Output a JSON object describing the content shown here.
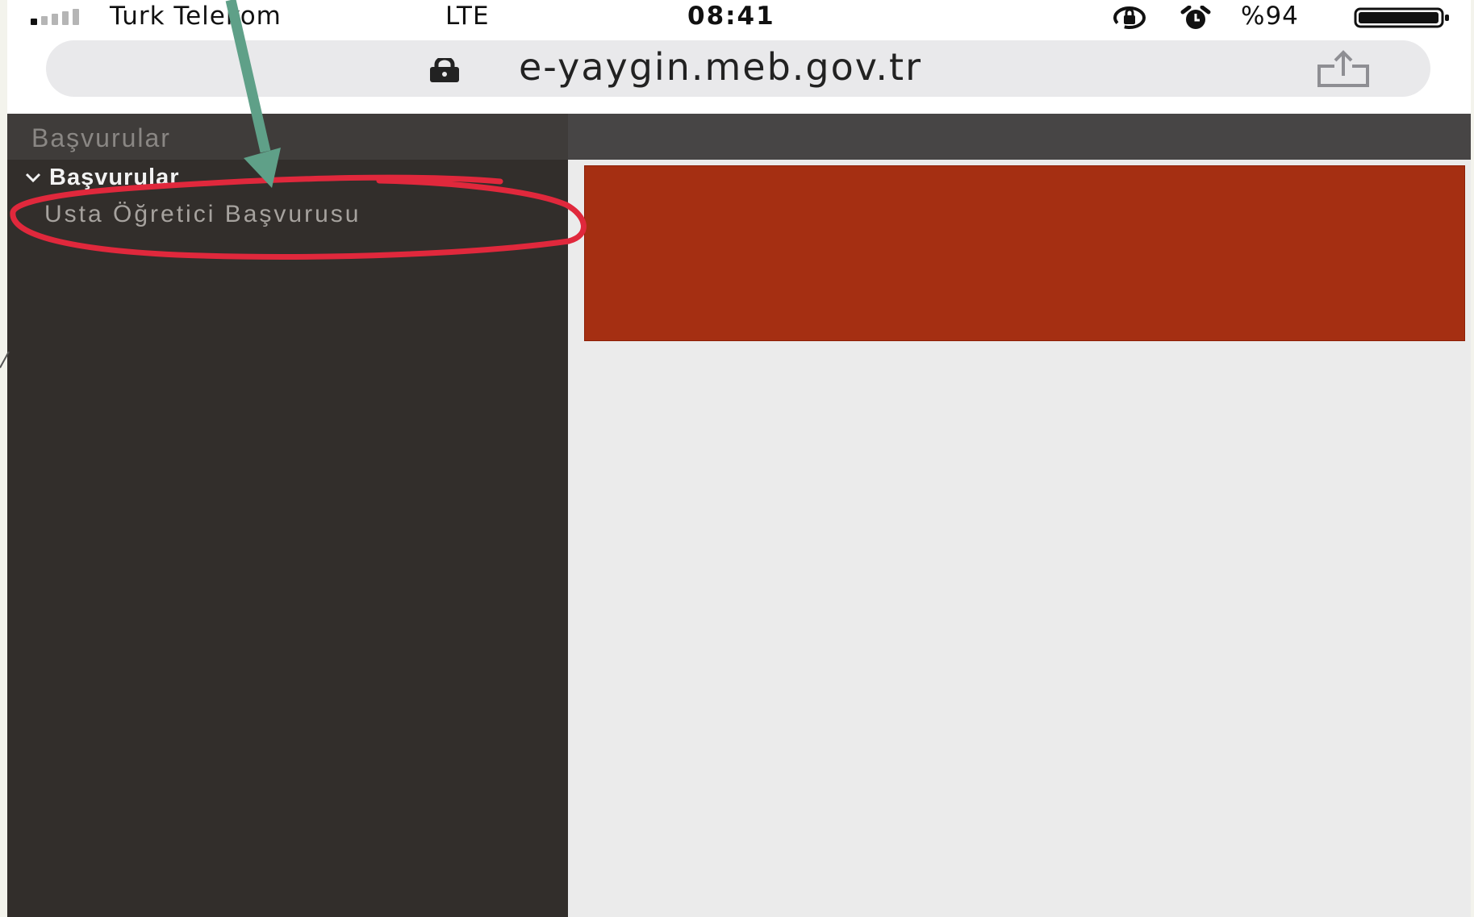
{
  "status_bar": {
    "carrier": "Turk Telekom",
    "network": "LTE",
    "time": "08:41",
    "battery_percent": "%94",
    "signal_strength": 1,
    "icons": [
      "signal-icon",
      "orientation-lock-icon",
      "alarm-icon",
      "battery-icon"
    ]
  },
  "browser": {
    "url": "e-yaygin.meb.gov.tr",
    "icons": [
      "lock-icon",
      "share-icon"
    ]
  },
  "page": {
    "sidebar_title": "Başvurular",
    "menu_group": {
      "label": "Başvurular",
      "expanded": true,
      "items": [
        "Usta Öğretici Başvurusu"
      ]
    },
    "banner_color": "#a52f12"
  },
  "annotations": {
    "arrow_color": "#5fa088",
    "highlight_circle_color": "#e0283c",
    "highlights": "Usta Öğretici Başvurusu"
  },
  "colors": {
    "sidebar_bg": "#322e2b",
    "header_bg": "#474545",
    "content_bg": "#ebebeb",
    "url_bar_bg": "#e9e9eb"
  }
}
